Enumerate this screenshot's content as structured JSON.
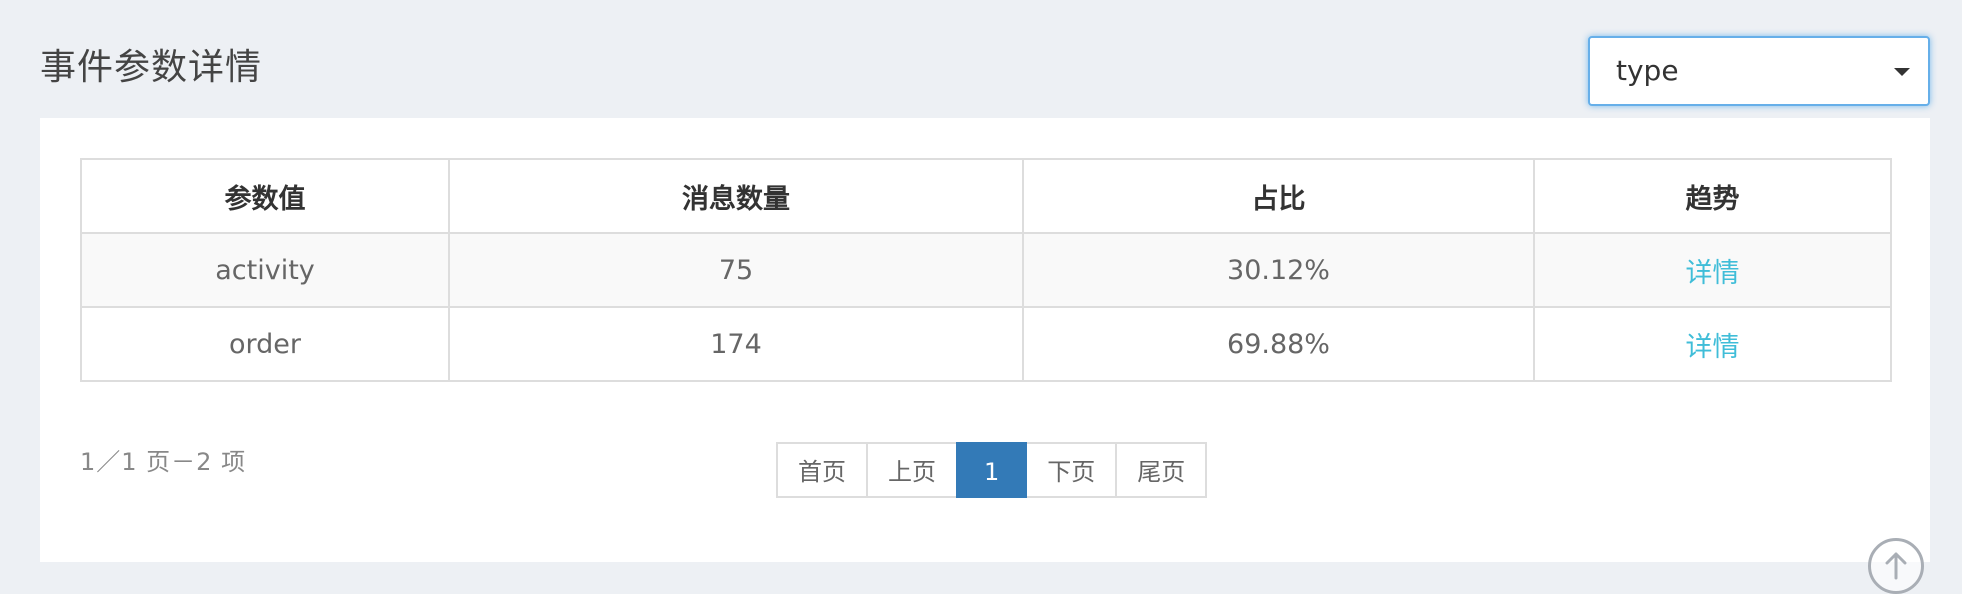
{
  "header": {
    "title": "事件参数详情"
  },
  "param_select": {
    "value": "type"
  },
  "table": {
    "columns": [
      "参数值",
      "消息数量",
      "占比",
      "趋势"
    ],
    "rows": [
      {
        "value": "activity",
        "count": "75",
        "ratio": "30.12%",
        "trend": "详情"
      },
      {
        "value": "order",
        "count": "174",
        "ratio": "69.88%",
        "trend": "详情"
      }
    ]
  },
  "pagination": {
    "info": "1／1 页－2 项",
    "first": "首页",
    "prev": "上页",
    "current": "1",
    "next": "下页",
    "last": "尾页"
  },
  "icons": {
    "select_caret": "chevron-down-icon",
    "back_to_top": "arrow-up-icon"
  },
  "colors": {
    "link": "#3fbdd8",
    "active_page": "#337ab7",
    "focus_border": "#66afe9"
  }
}
